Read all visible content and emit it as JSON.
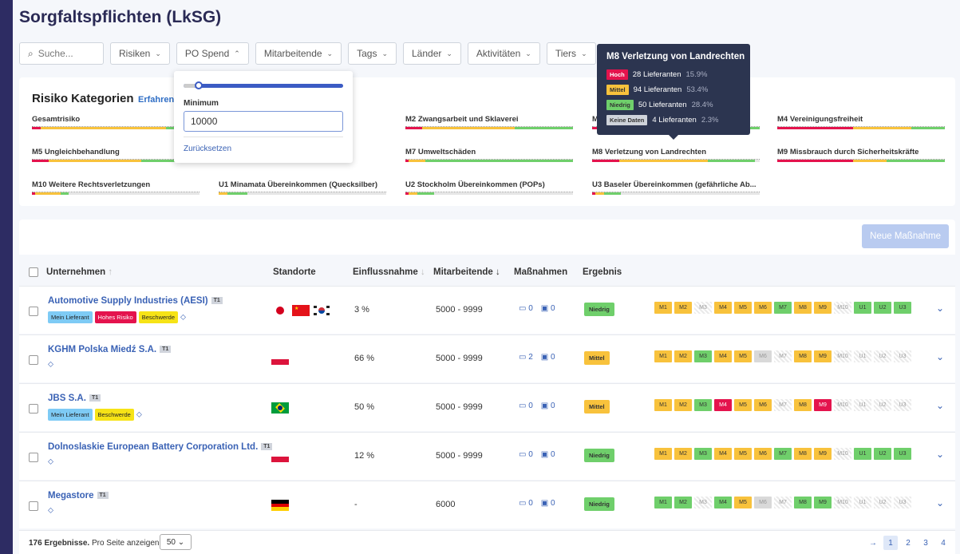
{
  "page_title": "Sorgfaltspflichten (LkSG)",
  "filters": {
    "search_placeholder": "Suche...",
    "items": [
      "Risiken",
      "PO Spend",
      "Mitarbeitende",
      "Tags",
      "Länder",
      "Aktivitäten",
      "Tiers"
    ]
  },
  "dropdown": {
    "label": "Minimum",
    "value": "10000",
    "reset": "Zurücksetzen"
  },
  "risk": {
    "title": "Risiko Kategorien",
    "link": "Erfahren",
    "categories": [
      {
        "label": "Gesamtrisiko",
        "red": 0.05,
        "yellow": 0.75,
        "green": 0.2
      },
      {
        "label": "M2 Zwangsarbeit und Sklaverei",
        "red": 0.1,
        "yellow": 0.55,
        "green": 0.35
      },
      {
        "label": "M",
        "red": 0.1,
        "yellow": 0.5,
        "green": 0.4
      },
      {
        "label": "M4 Vereinigungsfreiheit",
        "red": 0.45,
        "yellow": 0.35,
        "green": 0.2
      },
      {
        "label": "M5 Ungleichbehandlung",
        "red": 0.1,
        "yellow": 0.55,
        "green": 0.35
      },
      {
        "label": "M7 Umweltschäden",
        "red": 0.02,
        "yellow": 0.1,
        "green": 0.88
      },
      {
        "label": "M8 Verletzung von Landrechten",
        "red": 0.16,
        "yellow": 0.53,
        "green": 0.28
      },
      {
        "label": "M9 Missbrauch durch Sicherheitskräfte",
        "red": 0.45,
        "yellow": 0.2,
        "green": 0.35
      },
      {
        "label": "M10 Weitere Rechtsverletzungen",
        "red": 0.02,
        "yellow": 0.15,
        "green": 0.05
      },
      {
        "label": "U1 Minamata Übereinkommen (Quecksilber)",
        "red": 0.0,
        "yellow": 0.05,
        "green": 0.12
      },
      {
        "label": "U2 Stockholm Übereinkommen (POPs)",
        "red": 0.02,
        "yellow": 0.05,
        "green": 0.1
      },
      {
        "label": "U3 Baseler Übereinkommen (gefährliche Ab...",
        "red": 0.02,
        "yellow": 0.05,
        "green": 0.1
      }
    ]
  },
  "tooltip": {
    "title": "M8 Verletzung von Landrechten",
    "rows": [
      {
        "badge": "Hoch",
        "text": "28 Lieferanten",
        "pct": "15.9%",
        "color": "#e4134d"
      },
      {
        "badge": "Mittel",
        "text": "94 Lieferanten",
        "pct": "53.4%",
        "color": "#f8c23c"
      },
      {
        "badge": "Niedrig",
        "text": "50 Lieferanten",
        "pct": "28.4%",
        "color": "#6fcf6b"
      },
      {
        "badge": "Keine Daten",
        "text": "4 Lieferanten",
        "pct": "2.3%",
        "color": "#cfd3da"
      }
    ]
  },
  "actions": {
    "new_measure": "Neue Maßnahme"
  },
  "table": {
    "headers": {
      "company": "Unternehmen",
      "locations": "Standorte",
      "influence": "Einflussnahme",
      "employees": "Mitarbeitende",
      "measures": "Maßnahmen",
      "result": "Ergebnis"
    },
    "tier_label": "T1",
    "rows": [
      {
        "name": "Automotive Supply Industries (AESI)",
        "tags": [
          "Mein Lieferant",
          "Hohes Risiko",
          "Beschwerde"
        ],
        "flags": [
          "jp",
          "cn",
          "kr"
        ],
        "influence": "3 %",
        "employees": "5000 - 9999",
        "m1": "0",
        "m2": "0",
        "result": "Niedrig",
        "ms": [
          "y",
          "y",
          "h",
          "y",
          "y",
          "y",
          "g",
          "y",
          "y",
          "h",
          "g",
          "g",
          "g"
        ]
      },
      {
        "name": "KGHM Polska Miedź S.A.",
        "tags": [],
        "flags": [
          "pl"
        ],
        "influence": "66 %",
        "employees": "5000 - 9999",
        "m1": "2",
        "m2": "0",
        "result": "Mittel",
        "ms": [
          "y",
          "y",
          "g",
          "y",
          "y",
          "l",
          "h",
          "y",
          "y",
          "h",
          "h",
          "h",
          "h"
        ]
      },
      {
        "name": "JBS S.A.",
        "tags": [
          "Mein Lieferant",
          "Beschwerde"
        ],
        "flags": [
          "br"
        ],
        "influence": "50 %",
        "employees": "5000 - 9999",
        "m1": "0",
        "m2": "0",
        "result": "Mittel",
        "ms": [
          "y",
          "y",
          "g",
          "r",
          "y",
          "y",
          "h",
          "y",
          "r",
          "h",
          "h",
          "h",
          "h"
        ]
      },
      {
        "name": "Dolnoslaskie European Battery Corporation Ltd.",
        "tags": [],
        "flags": [
          "pl"
        ],
        "influence": "12 %",
        "employees": "5000 - 9999",
        "m1": "0",
        "m2": "0",
        "result": "Niedrig",
        "ms": [
          "y",
          "y",
          "g",
          "y",
          "y",
          "y",
          "g",
          "y",
          "y",
          "h",
          "g",
          "g",
          "g"
        ]
      },
      {
        "name": "Megastore",
        "tags": [],
        "flags": [
          "de"
        ],
        "influence": "-",
        "employees": "6000",
        "m1": "0",
        "m2": "0",
        "result": "Niedrig",
        "ms": [
          "g",
          "g",
          "h",
          "g",
          "y",
          "l",
          "h",
          "g",
          "g",
          "h",
          "h",
          "h",
          "h"
        ]
      }
    ]
  },
  "m_labels": [
    "M1",
    "M2",
    "M3",
    "M4",
    "M5",
    "M6",
    "M7",
    "M8",
    "M9",
    "M10",
    "U1",
    "U2",
    "U3"
  ],
  "footer": {
    "results": "176 Ergebnisse.",
    "per_page": "Pro Seite anzeigen",
    "page_size": "50",
    "pages": [
      "1",
      "2",
      "3",
      "4"
    ]
  },
  "colors": {
    "red": "#e4134d",
    "yellow": "#f8c23c",
    "green": "#6fcf6b",
    "grey": "#d9d9d9",
    "blue_tag": "#7ecbf5",
    "accent": "#3b5bc4"
  }
}
